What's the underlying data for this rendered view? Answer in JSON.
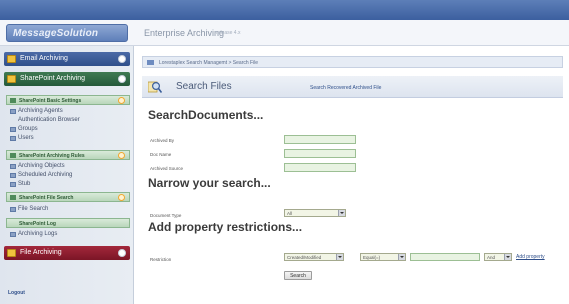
{
  "header": {
    "logo_text": "MessageSolution",
    "title": "Enterprise Archiving",
    "subtitle": "release 4.x"
  },
  "sidebar": {
    "email_archiving": "Email Archiving",
    "sharepoint_archiving": "SharePoint Archiving",
    "file_archiving": "File Archiving",
    "sections": [
      {
        "label": "SharePoint Basic Settings",
        "items": [
          "Archiving Agents",
          "Authentication Browser",
          "Groups",
          "Users"
        ]
      },
      {
        "label": "SharePoint Archiving Rules",
        "items": [
          "Archiving Objects",
          "Scheduled Archiving",
          "Stub"
        ]
      },
      {
        "label": "SharePoint File Search",
        "items": [
          "File Search"
        ]
      },
      {
        "label": "SharePoint Log",
        "items": [
          "Archiving Logs"
        ]
      }
    ],
    "logout": "Logout"
  },
  "main": {
    "breadcrumb": "Lorestaplex Search Managemt > Search File",
    "search_title": "Search Files",
    "search_link": "Search Recovered Archived File",
    "heading_search": "SearchDocuments...",
    "fields": [
      {
        "label": "Archived By"
      },
      {
        "label": "Doc Name"
      },
      {
        "label": "Archived Source"
      }
    ],
    "heading_narrow": "Narrow your search...",
    "doc_type_label": "Document Type",
    "doc_type_value": "All",
    "heading_props": "Add property restrictions...",
    "prop_label": "Restriction",
    "prop_select_1": "Created/Modified",
    "prop_select_2": "Equal(=)",
    "prop_select_3": "And",
    "prop_add_link": "Add property",
    "search_button": "Search"
  }
}
